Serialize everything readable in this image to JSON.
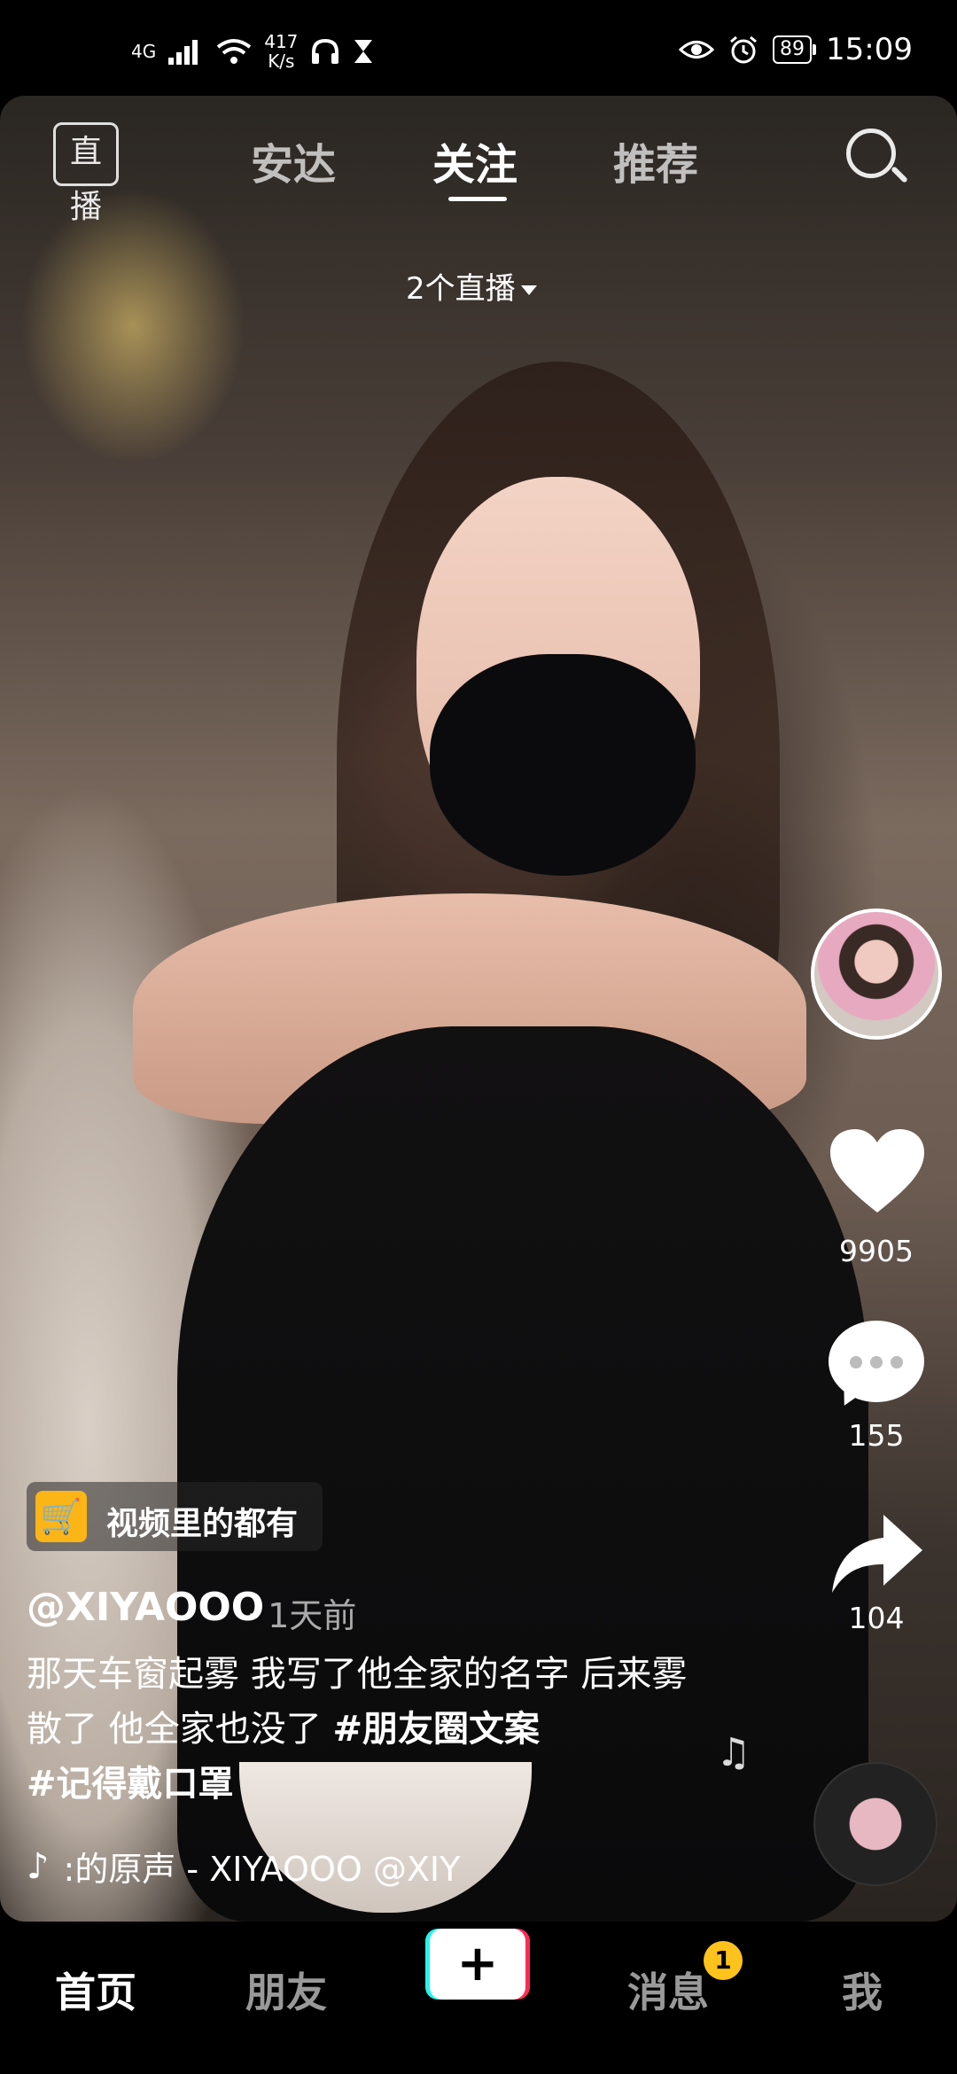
{
  "status_bar": {
    "network": "4G",
    "speed_value": "417",
    "speed_unit": "K/s",
    "battery": "89",
    "time": "15:09"
  },
  "top_nav": {
    "live_label": "直播",
    "tabs": [
      {
        "label": "安达"
      },
      {
        "label": "关注"
      },
      {
        "label": "推荐"
      }
    ],
    "live_count": "2个直播"
  },
  "sidebar": {
    "likes": "9905",
    "comments": "155",
    "shares": "104"
  },
  "video_info": {
    "cart_label": "视频里的都有",
    "author": "@XIYAOOO",
    "time": "· 1天前",
    "caption_text": "那天车窗起雾 我写了他全家的名字 后来雾散了 他全家也没了 ",
    "hashtag1": "#朋友圈文案",
    "hashtag2": "#记得戴口罩",
    "sound": ":的原声 - XIYAOOO    @XIY"
  },
  "bottom_nav": {
    "home": "首页",
    "friends": "朋友",
    "plus": "+",
    "messages": "消息",
    "messages_badge": "1",
    "me": "我"
  },
  "colors": {
    "accent_cart": "#fbb516",
    "badge": "#fdc21c",
    "tiktok_cyan": "#25f4ee",
    "tiktok_red": "#fe2c55"
  }
}
